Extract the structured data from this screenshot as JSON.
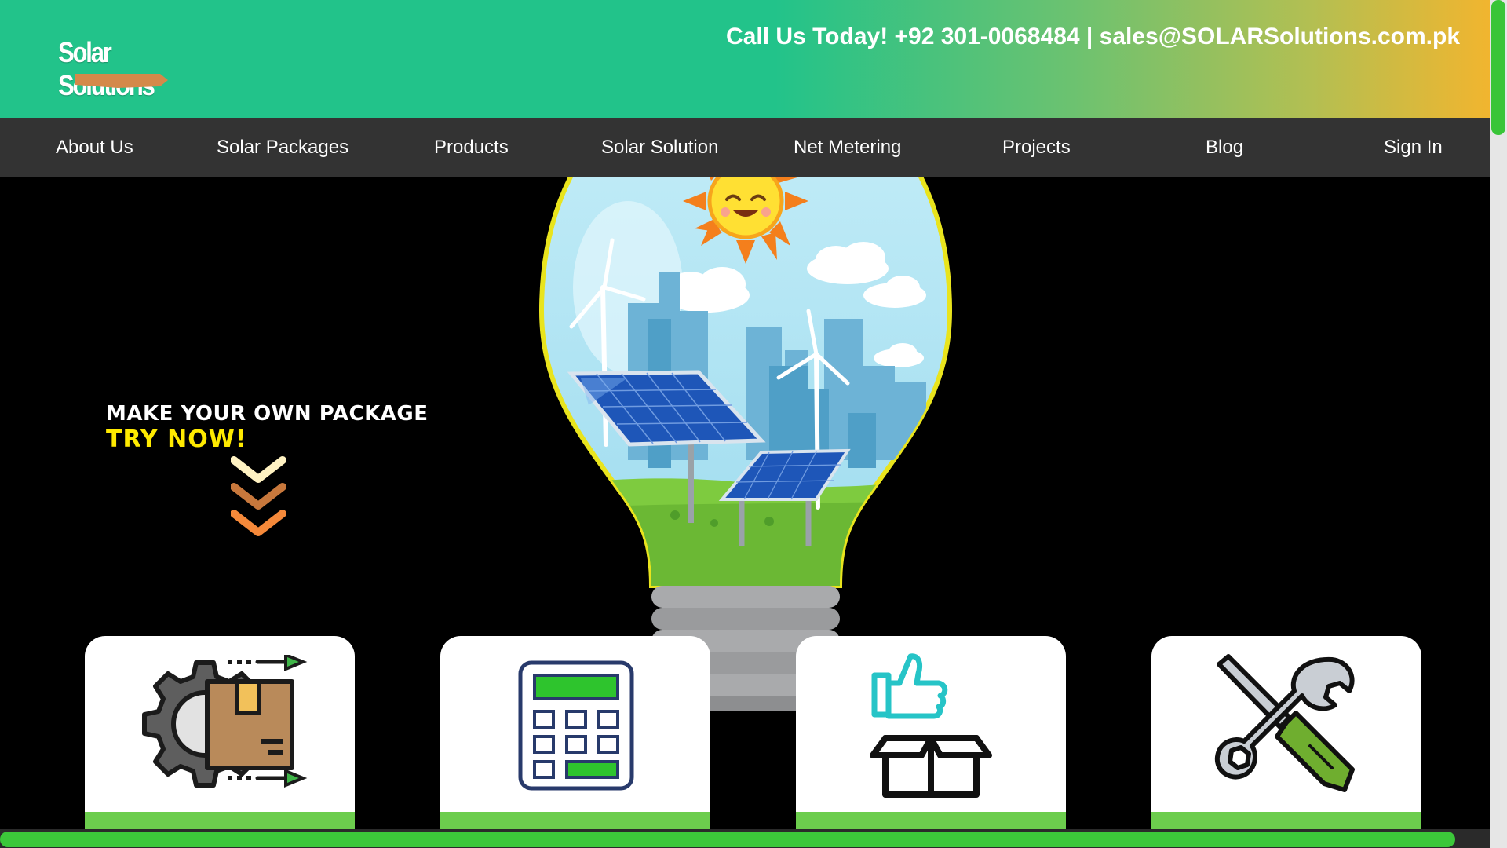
{
  "header": {
    "logo_text": "Solar Solutions",
    "contact": "Call Us Today! +92 301-0068484 | sales@SOLARSolutions.com.pk",
    "gradient_colors": [
      "#22c38a",
      "#6cc270",
      "#b3bf52",
      "#f1b52f"
    ]
  },
  "nav": {
    "items": [
      {
        "label": "About Us"
      },
      {
        "label": "Solar Packages"
      },
      {
        "label": "Products"
      },
      {
        "label": "Solar Solution"
      },
      {
        "label": "Net Metering"
      },
      {
        "label": "Projects"
      },
      {
        "label": "Blog"
      },
      {
        "label": "Sign In"
      }
    ],
    "background": "#333333"
  },
  "hero": {
    "cta_line1": "MAKE YOUR OWN PACKAGE",
    "cta_line2": "TRY NOW!",
    "cta_line2_color": "#ffea00",
    "chevron_colors": [
      "#fff2c2",
      "#c8783c",
      "#f5893a"
    ],
    "illustration": "lightbulb-with-sun-city-wind-turbines-solar-panels"
  },
  "cards": [
    {
      "icon": "gear-box-delivery-icon"
    },
    {
      "icon": "calculator-icon"
    },
    {
      "icon": "thumbs-up-box-icon"
    },
    {
      "icon": "wrench-screwdriver-icon"
    }
  ],
  "accent_color": "#3cc73a"
}
